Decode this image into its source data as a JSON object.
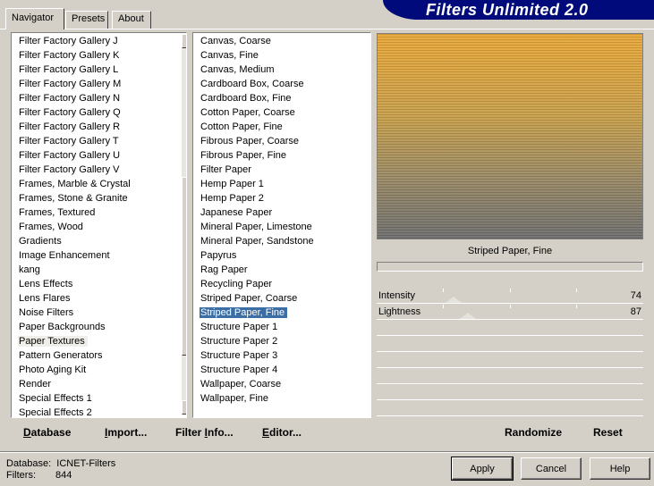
{
  "tabs": [
    {
      "label": "Navigator",
      "active": true
    },
    {
      "label": "Presets",
      "active": false
    },
    {
      "label": "About",
      "active": false
    }
  ],
  "title": "Filters Unlimited 2.0",
  "categories": {
    "items": [
      "Filter Factory Gallery J",
      "Filter Factory Gallery K",
      "Filter Factory Gallery L",
      "Filter Factory Gallery M",
      "Filter Factory Gallery N",
      "Filter Factory Gallery Q",
      "Filter Factory Gallery R",
      "Filter Factory Gallery T",
      "Filter Factory Gallery U",
      "Filter Factory Gallery V",
      "Frames, Marble & Crystal",
      "Frames, Stone & Granite",
      "Frames, Textured",
      "Frames, Wood",
      "Gradients",
      "Image Enhancement",
      "kang",
      "Lens Effects",
      "Lens Flares",
      "Noise Filters",
      "Paper Backgrounds",
      "Paper Textures",
      "Pattern Generators",
      "Photo Aging Kit",
      "Render",
      "Special Effects 1",
      "Special Effects 2"
    ],
    "selected_index": 21
  },
  "filters": {
    "items": [
      "Canvas, Coarse",
      "Canvas, Fine",
      "Canvas, Medium",
      "Cardboard Box, Coarse",
      "Cardboard Box, Fine",
      "Cotton Paper, Coarse",
      "Cotton Paper, Fine",
      "Fibrous Paper, Coarse",
      "Fibrous Paper, Fine",
      "Filter Paper",
      "Hemp Paper 1",
      "Hemp Paper 2",
      "Japanese Paper",
      "Mineral Paper, Limestone",
      "Mineral Paper, Sandstone",
      "Papyrus",
      "Rag Paper",
      "Recycling Paper",
      "Striped Paper, Coarse",
      "Striped Paper, Fine",
      "Structure Paper 1",
      "Structure Paper 2",
      "Structure Paper 3",
      "Structure Paper 4",
      "Wallpaper, Coarse",
      "Wallpaper, Fine"
    ],
    "selected_index": 19
  },
  "preview": {
    "caption": "Striped Paper, Fine",
    "colors": {
      "top": "#eaa838",
      "bottom": "#6e6e6e"
    }
  },
  "params": [
    {
      "label": "Intensity",
      "value": "74"
    },
    {
      "label": "Lightness",
      "value": "87"
    }
  ],
  "toolbar": {
    "database_prefix": "",
    "database_key": "D",
    "database_rest": "atabase",
    "import_prefix": "",
    "import_key": "I",
    "import_rest": "mport...",
    "filterinfo_prefix": "Filter ",
    "filterinfo_key": "I",
    "filterinfo_rest": "nfo...",
    "editor_prefix": "",
    "editor_key": "E",
    "editor_rest": "ditor...",
    "randomize": "Randomize",
    "reset": "Reset"
  },
  "buttons": {
    "apply": "Apply",
    "cancel": "Cancel",
    "help": "Help"
  },
  "status": {
    "database_label": "Database:",
    "database_value": "ICNET-Filters",
    "filters_label": "Filters:",
    "filters_value": "844"
  }
}
